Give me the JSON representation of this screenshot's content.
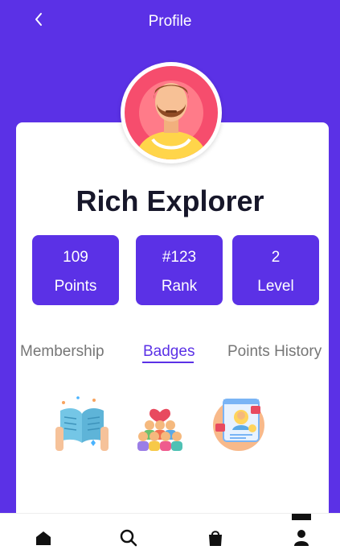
{
  "header": {
    "title": "Profile",
    "back_icon": "chevron-left-icon"
  },
  "profile": {
    "name": "Rich Explorer"
  },
  "stats": [
    {
      "value": "109",
      "label": "Points"
    },
    {
      "value": "#123",
      "label": "Rank"
    },
    {
      "value": "2",
      "label": "Level"
    }
  ],
  "tabs": [
    {
      "label": "Membership",
      "active": false
    },
    {
      "label": "Badges",
      "active": true
    },
    {
      "label": "Points History",
      "active": false
    }
  ],
  "badges": [
    "open-book-icon",
    "community-heart-icon",
    "social-profile-icon"
  ],
  "bottom_nav": [
    "home-icon",
    "search-icon",
    "shopping-bag-icon",
    "user-icon"
  ],
  "colors": {
    "brand": "#5b31e6",
    "text_dark": "#17172a",
    "tab_inactive": "#767676"
  }
}
